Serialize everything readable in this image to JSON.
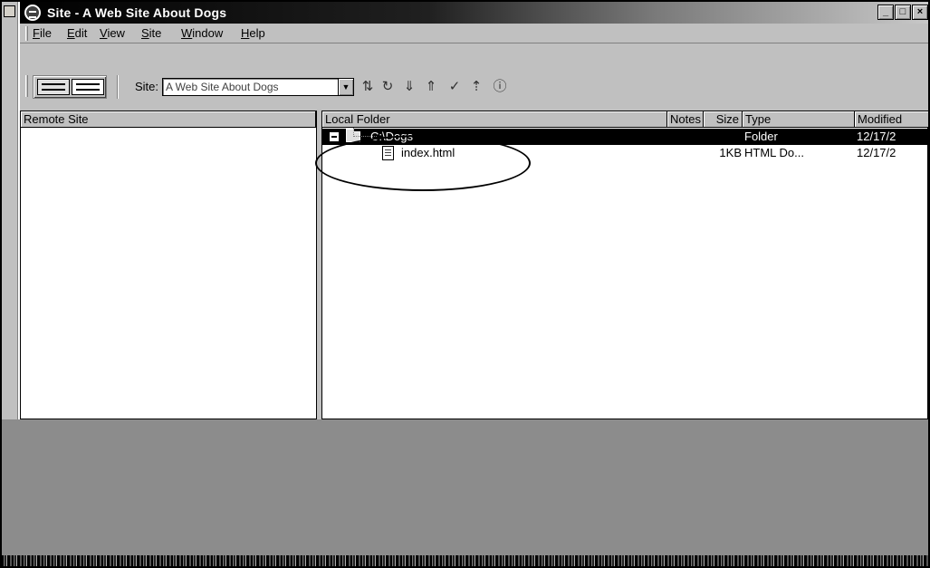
{
  "window": {
    "title": "Site - A Web Site About Dogs",
    "controls": {
      "minimize": "_",
      "maximize": "□",
      "close": "×"
    }
  },
  "menu": [
    {
      "label": "File",
      "accel": "F"
    },
    {
      "label": "Edit",
      "accel": "E"
    },
    {
      "label": "View",
      "accel": "V"
    },
    {
      "label": "Site",
      "accel": "S"
    },
    {
      "label": "Window",
      "accel": "W"
    },
    {
      "label": "Help",
      "accel": "H"
    }
  ],
  "toolbar": {
    "site_label": "Site:",
    "site_value": "A Web Site About Dogs",
    "icons": [
      "connect-icon",
      "refresh-icon",
      "get-icon",
      "put-icon",
      "checkout-icon",
      "checkin-icon",
      "help-icon"
    ]
  },
  "remote_panel": {
    "header": "Remote Site"
  },
  "local_panel": {
    "columns": [
      "Local Folder",
      "Notes",
      "Size",
      "Type",
      "Modified"
    ],
    "rows": [
      {
        "name": "C:\\Dogs",
        "notes": "",
        "size": "",
        "type": "Folder",
        "modified": "12/17/2",
        "selected": true,
        "kind": "folder"
      },
      {
        "name": "index.html",
        "notes": "",
        "size": "1KB",
        "type": "HTML Do...",
        "modified": "12/17/2",
        "selected": false,
        "kind": "file"
      }
    ]
  },
  "colors": {
    "window_face": "#c0c0c0",
    "selection": "#000000",
    "overlay_gray": "#8c8c8c"
  }
}
